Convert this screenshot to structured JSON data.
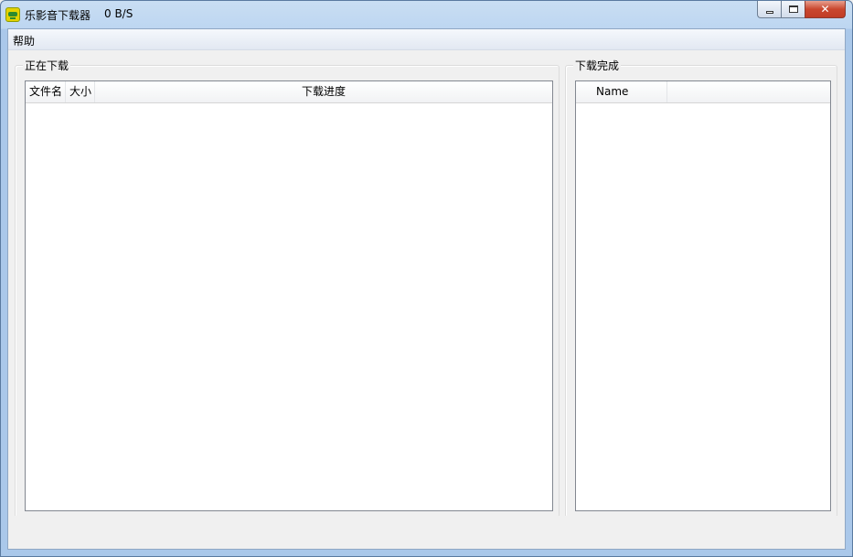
{
  "window": {
    "title": "乐影音下载器",
    "speed": "0 B/S",
    "close_glyph": "✕"
  },
  "menu": {
    "items": [
      {
        "label": "帮助"
      }
    ]
  },
  "downloading": {
    "group_label": "正在下载",
    "columns": [
      {
        "label": "文件名"
      },
      {
        "label": "大小"
      },
      {
        "label": "下载进度"
      }
    ],
    "rows": []
  },
  "completed": {
    "group_label": "下载完成",
    "columns": [
      {
        "label": "Name"
      }
    ],
    "rows": []
  },
  "icons": {
    "app": "app-logo-icon",
    "minimize": "minimize-icon",
    "maximize": "maximize-icon",
    "close": "close-icon"
  }
}
